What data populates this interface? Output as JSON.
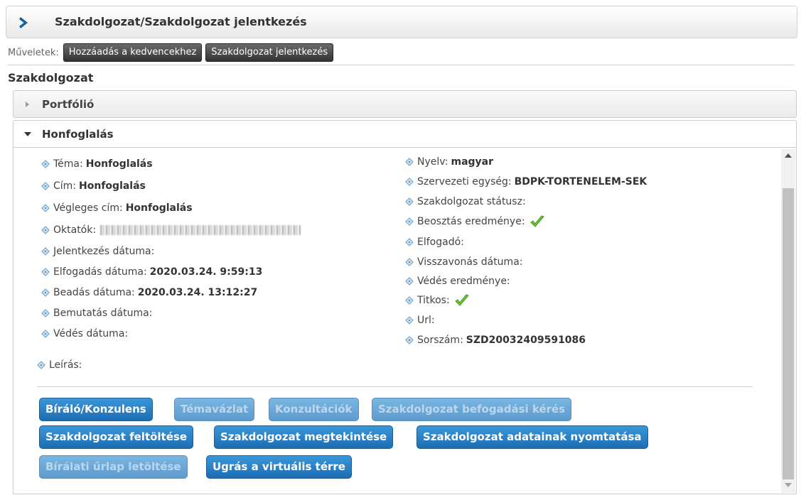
{
  "header": {
    "title": "Szakdolgozat/Szakdolgozat jelentkezés"
  },
  "operations": {
    "label": "Műveletek:",
    "buttons": [
      "Hozzáadás a kedvencekhez",
      "Szakdolgozat jelentkezés"
    ]
  },
  "section_title": "Szakdolgozat",
  "accordion": {
    "portfolio": "Portfólió",
    "thesis": "Honfoglalás"
  },
  "left_fields": [
    {
      "label": "Téma:",
      "value": "Honfoglalás"
    },
    {
      "label": "Cím:",
      "value": "Honfoglalás"
    },
    {
      "label": "Végleges cím:",
      "value": "Honfoglalás"
    },
    {
      "label": "Oktatók:",
      "value": ""
    },
    {
      "label": "Jelentkezés dátuma:",
      "value": ""
    },
    {
      "label": "Elfogadás dátuma:",
      "value": "2020.03.24. 9:59:13"
    },
    {
      "label": "Beadás dátuma:",
      "value": "2020.03.24. 13:12:27"
    },
    {
      "label": "Bemutatás dátuma:",
      "value": ""
    },
    {
      "label": "Védés dátuma:",
      "value": ""
    },
    {
      "label": "Leírás:",
      "value": ""
    }
  ],
  "right_fields": [
    {
      "label": "Nyelv:",
      "value": "magyar"
    },
    {
      "label": "Szervezeti egység:",
      "value": "BDPK-TORTENELEM-SEK"
    },
    {
      "label": "Szakdolgozat státusz:",
      "value": ""
    },
    {
      "label": "Beosztás eredménye:",
      "value": ""
    },
    {
      "label": "Elfogadó:",
      "value": ""
    },
    {
      "label": "Visszavonás dátuma:",
      "value": ""
    },
    {
      "label": "Védés eredménye:",
      "value": ""
    },
    {
      "label": "Titkos:",
      "value": ""
    },
    {
      "label": "Url:",
      "value": ""
    },
    {
      "label": "Sorszám:",
      "value": "SZD20032409591086"
    }
  ],
  "action_buttons": [
    {
      "label": "Bíráló/Konzulens",
      "enabled": true
    },
    {
      "label": "Témavázlat",
      "enabled": false
    },
    {
      "label": "Konzultációk",
      "enabled": false
    },
    {
      "label": "Szakdolgozat befogadási kérés",
      "enabled": false
    },
    {
      "label": "Szakdolgozat feltöltése",
      "enabled": true
    },
    {
      "label": "Szakdolgozat megtekintése",
      "enabled": true
    },
    {
      "label": "Szakdolgozat adatainak nyomtatása",
      "enabled": true
    },
    {
      "label": "Bírálati űrlap letöltése",
      "enabled": false
    },
    {
      "label": "Ugrás a virtuális térre",
      "enabled": true
    }
  ],
  "icons": {
    "header": "chevron-right-icon",
    "bullet": "diamond-bullet-icon",
    "checkmark": "checkmark-icon",
    "accordion_closed": "triangle-right-icon",
    "accordion_open": "triangle-down-icon"
  },
  "colors": {
    "primary_button": "#2a80c6",
    "header_chevron": "#1f5f99",
    "checkmark": "#6cc23a",
    "dark_button": "#4a4a4a"
  }
}
